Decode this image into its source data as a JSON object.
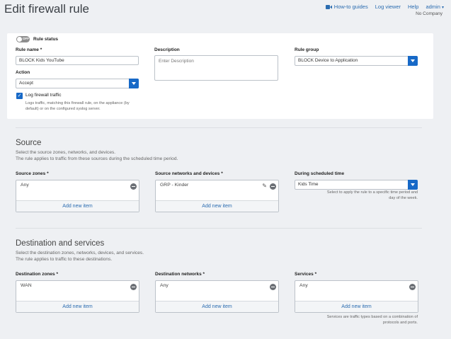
{
  "page": {
    "title": "Edit firewall rule"
  },
  "topnav": {
    "guides": "How-to guides",
    "log_viewer": "Log viewer",
    "help": "Help",
    "user": "admin",
    "company": "No Company"
  },
  "general": {
    "status_toggle": "OFF",
    "status_label": "Rule status",
    "rule_name_label": "Rule name",
    "rule_name_value": "BLOCK Kids YouTube",
    "description_label": "Description",
    "description_placeholder": "Enter Description",
    "rule_group_label": "Rule group",
    "rule_group_value": "BLOCK Device to Application",
    "action_label": "Action",
    "action_value": "Accept",
    "log_label": "Log firewall traffic",
    "log_help": [
      "Logs traffic, matching this firewall rule, on the appliance (by",
      "default) or on the configured syslog server."
    ],
    "required_mark": "*"
  },
  "source": {
    "title": "Source",
    "desc": [
      "Select the source zones, networks, and devices.",
      "The rule applies to traffic from these sources during the scheduled time period."
    ],
    "zones_label": "Source zones",
    "zones_item": "Any",
    "networks_label": "Source networks and devices",
    "networks_item": "GRP - Kinder",
    "schedule_label": "During scheduled time",
    "schedule_value": "Kids Time",
    "schedule_help": [
      "Select to apply the rule to a specific time period and",
      "day of the week."
    ],
    "add_label": "Add new item"
  },
  "destination": {
    "title": "Destination and services",
    "desc": [
      "Select the destination zones, networks, devices, and services.",
      "The rule applies to traffic to these destinations."
    ],
    "zones_label": "Destination zones",
    "zones_item": "WAN",
    "networks_label": "Destination networks",
    "networks_item": "Any",
    "services_label": "Services",
    "services_item": "Any",
    "services_help": [
      "Services are traffic types based on a combination of",
      "protocols and ports."
    ],
    "add_label": "Add new item"
  },
  "colors": {
    "accent": "#1769c7",
    "link": "#2b6cb0",
    "background": "#eef0f3"
  }
}
